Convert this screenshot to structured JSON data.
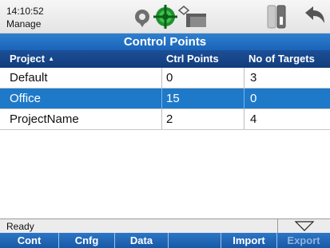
{
  "status": {
    "time": "14:10:52",
    "mode": "Manage",
    "icons": [
      "location-marker-icon",
      "target-gps-icon",
      "signal-icon",
      "screen-icon",
      "battery-icon",
      "back-arrow-icon"
    ]
  },
  "screen": {
    "title": "Control Points"
  },
  "table": {
    "columns": [
      "Project",
      "Ctrl Points",
      "No of Targets"
    ],
    "sort_indicator": "▲",
    "rows": [
      {
        "name": "Default",
        "ctrl_points": "0",
        "targets": "3",
        "selected": false
      },
      {
        "name": "Office",
        "ctrl_points": "15",
        "targets": "0",
        "selected": true
      },
      {
        "name": "ProjectName",
        "ctrl_points": "2",
        "targets": "4",
        "selected": false
      }
    ]
  },
  "status_line": {
    "text": "Ready",
    "dropdown_icon": "triangle-down-icon"
  },
  "softkeys": [
    {
      "label": "Cont",
      "enabled": true
    },
    {
      "label": "Cnfg",
      "enabled": true
    },
    {
      "label": "Data",
      "enabled": true
    },
    {
      "label": "",
      "enabled": true
    },
    {
      "label": "Import",
      "enabled": true
    },
    {
      "label": "Export",
      "enabled": false
    }
  ],
  "colors": {
    "title_bar": "#1a64b8",
    "header": "#123c7a",
    "selection": "#1e79c9",
    "softkey_bar": "#1759a6"
  }
}
